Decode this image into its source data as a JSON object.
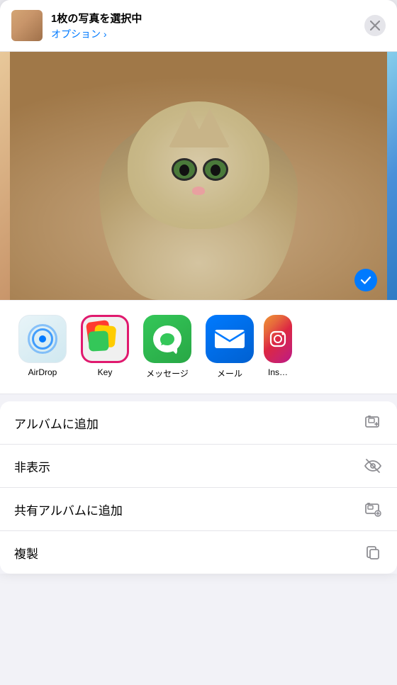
{
  "header": {
    "title": "1枚の写真を選択中",
    "option_label": "オプション ›",
    "close_label": "✕"
  },
  "share_apps": [
    {
      "id": "airdrop",
      "label": "AirDrop",
      "type": "airdrop"
    },
    {
      "id": "key",
      "label": "Key",
      "type": "key",
      "highlighted": true
    },
    {
      "id": "messages",
      "label": "メッセージ",
      "type": "messages"
    },
    {
      "id": "mail",
      "label": "メール",
      "type": "mail"
    },
    {
      "id": "instagram",
      "label": "Ins…",
      "type": "instagram"
    }
  ],
  "actions": [
    {
      "id": "add-album",
      "label": "アルバムに追加",
      "icon": "add-album-icon"
    },
    {
      "id": "hide",
      "label": "非表示",
      "icon": "hide-icon"
    },
    {
      "id": "shared-album",
      "label": "共有アルバムに追加",
      "icon": "shared-album-icon"
    },
    {
      "id": "duplicate",
      "label": "複製",
      "icon": "duplicate-icon"
    }
  ],
  "colors": {
    "accent": "#007aff",
    "highlight_border": "#e0196e",
    "label_color": "#000000",
    "secondary": "#8e8e93"
  }
}
